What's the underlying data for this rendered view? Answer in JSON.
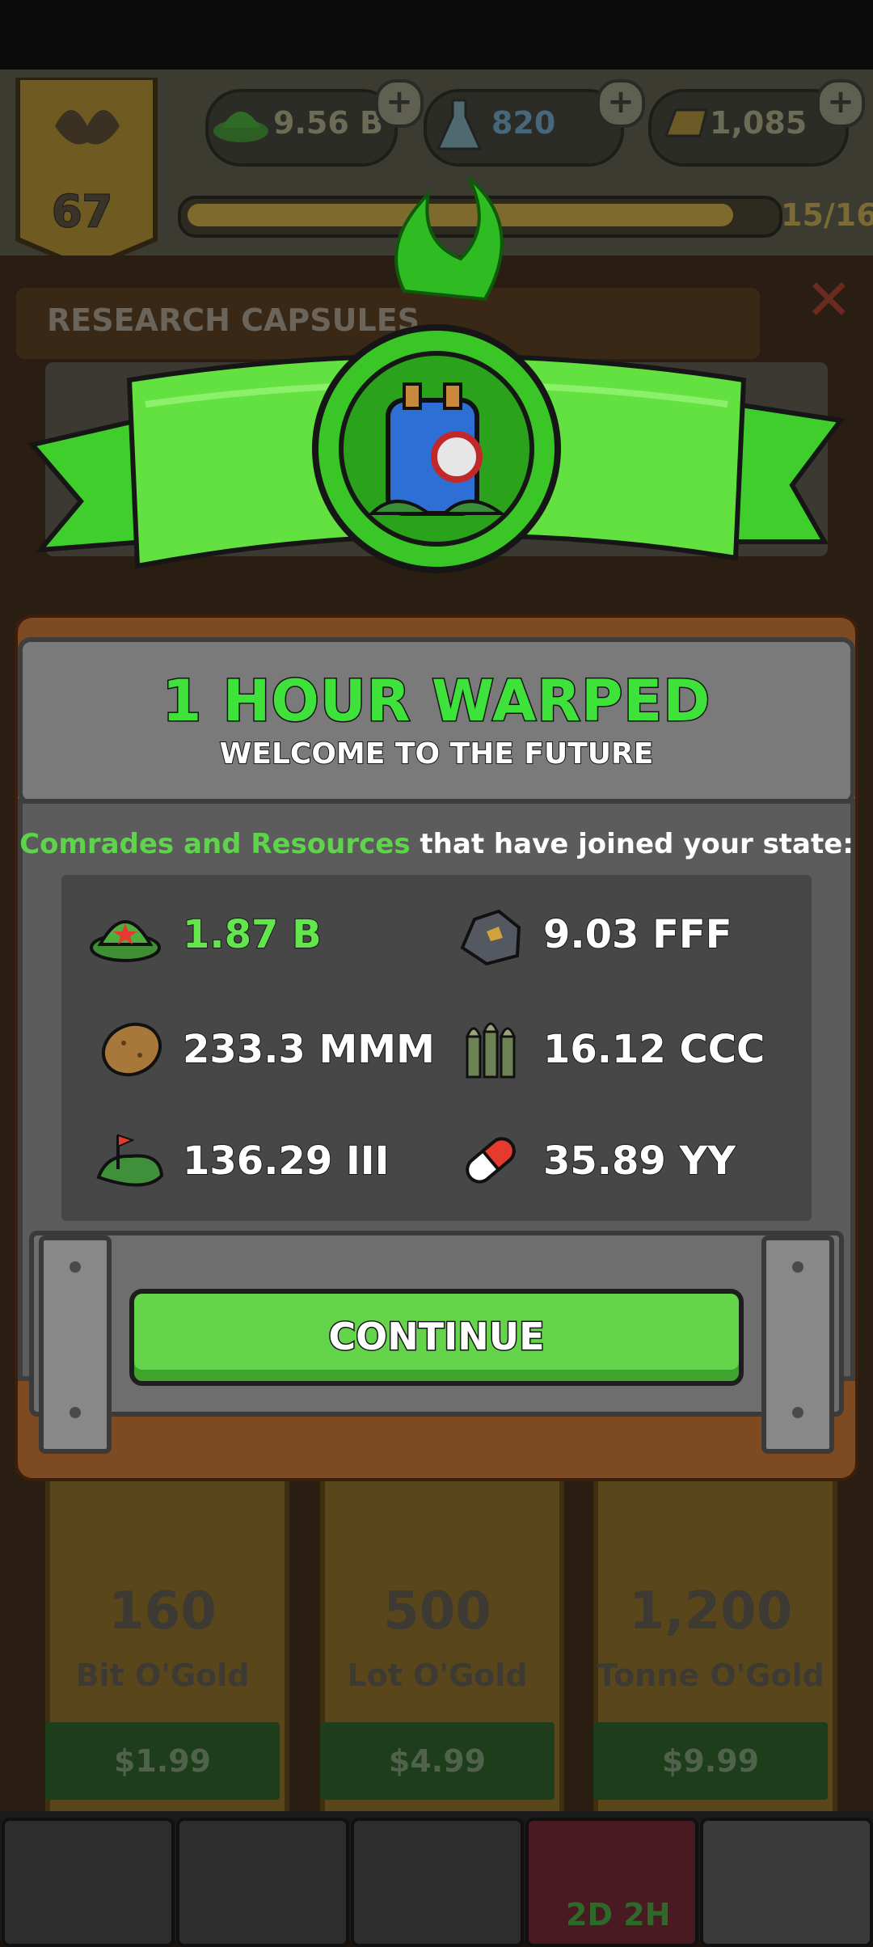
{
  "top_bar": {
    "level": "67",
    "currencies": [
      {
        "icon": "comrade-cap-icon",
        "value": "9.56 B"
      },
      {
        "icon": "science-flask-icon",
        "value": "820"
      },
      {
        "icon": "gold-bar-icon",
        "value": "1,085"
      }
    ],
    "progress_fraction": 0.9375,
    "progress_text": "15/16"
  },
  "background": {
    "research_title": "RESEARCH CAPSULES",
    "gold_cards": [
      {
        "amount": "160",
        "name": "Bit O'Gold",
        "price": "$1.99"
      },
      {
        "amount": "500",
        "name": "Lot O'Gold",
        "price": "$4.99"
      },
      {
        "amount": "1,200",
        "name": "Tonne O'Gold",
        "price": "$9.99"
      }
    ],
    "nav_timer": "2D 2H"
  },
  "dialog": {
    "title": "1 HOUR WARPED",
    "subtitle": "WELCOME TO THE FUTURE",
    "joined_highlight": "Comrades and Resources",
    "joined_rest": " that have joined your state:",
    "resources": [
      {
        "icon": "comrade-cap-icon",
        "value": "1.87 B"
      },
      {
        "icon": "ore-icon",
        "value": "9.03 FFF"
      },
      {
        "icon": "potato-icon",
        "value": "233.3 MMM"
      },
      {
        "icon": "bullets-icon",
        "value": "16.12 CCC"
      },
      {
        "icon": "land-flag-icon",
        "value": "136.29 III"
      },
      {
        "icon": "pill-icon",
        "value": "35.89 YY"
      }
    ],
    "continue_label": "CONTINUE"
  },
  "colors": {
    "accent_green": "#3ee23a",
    "button_green": "#64d54a",
    "highlight_green": "#5fd34c",
    "wood_brown": "#7e4a22"
  }
}
